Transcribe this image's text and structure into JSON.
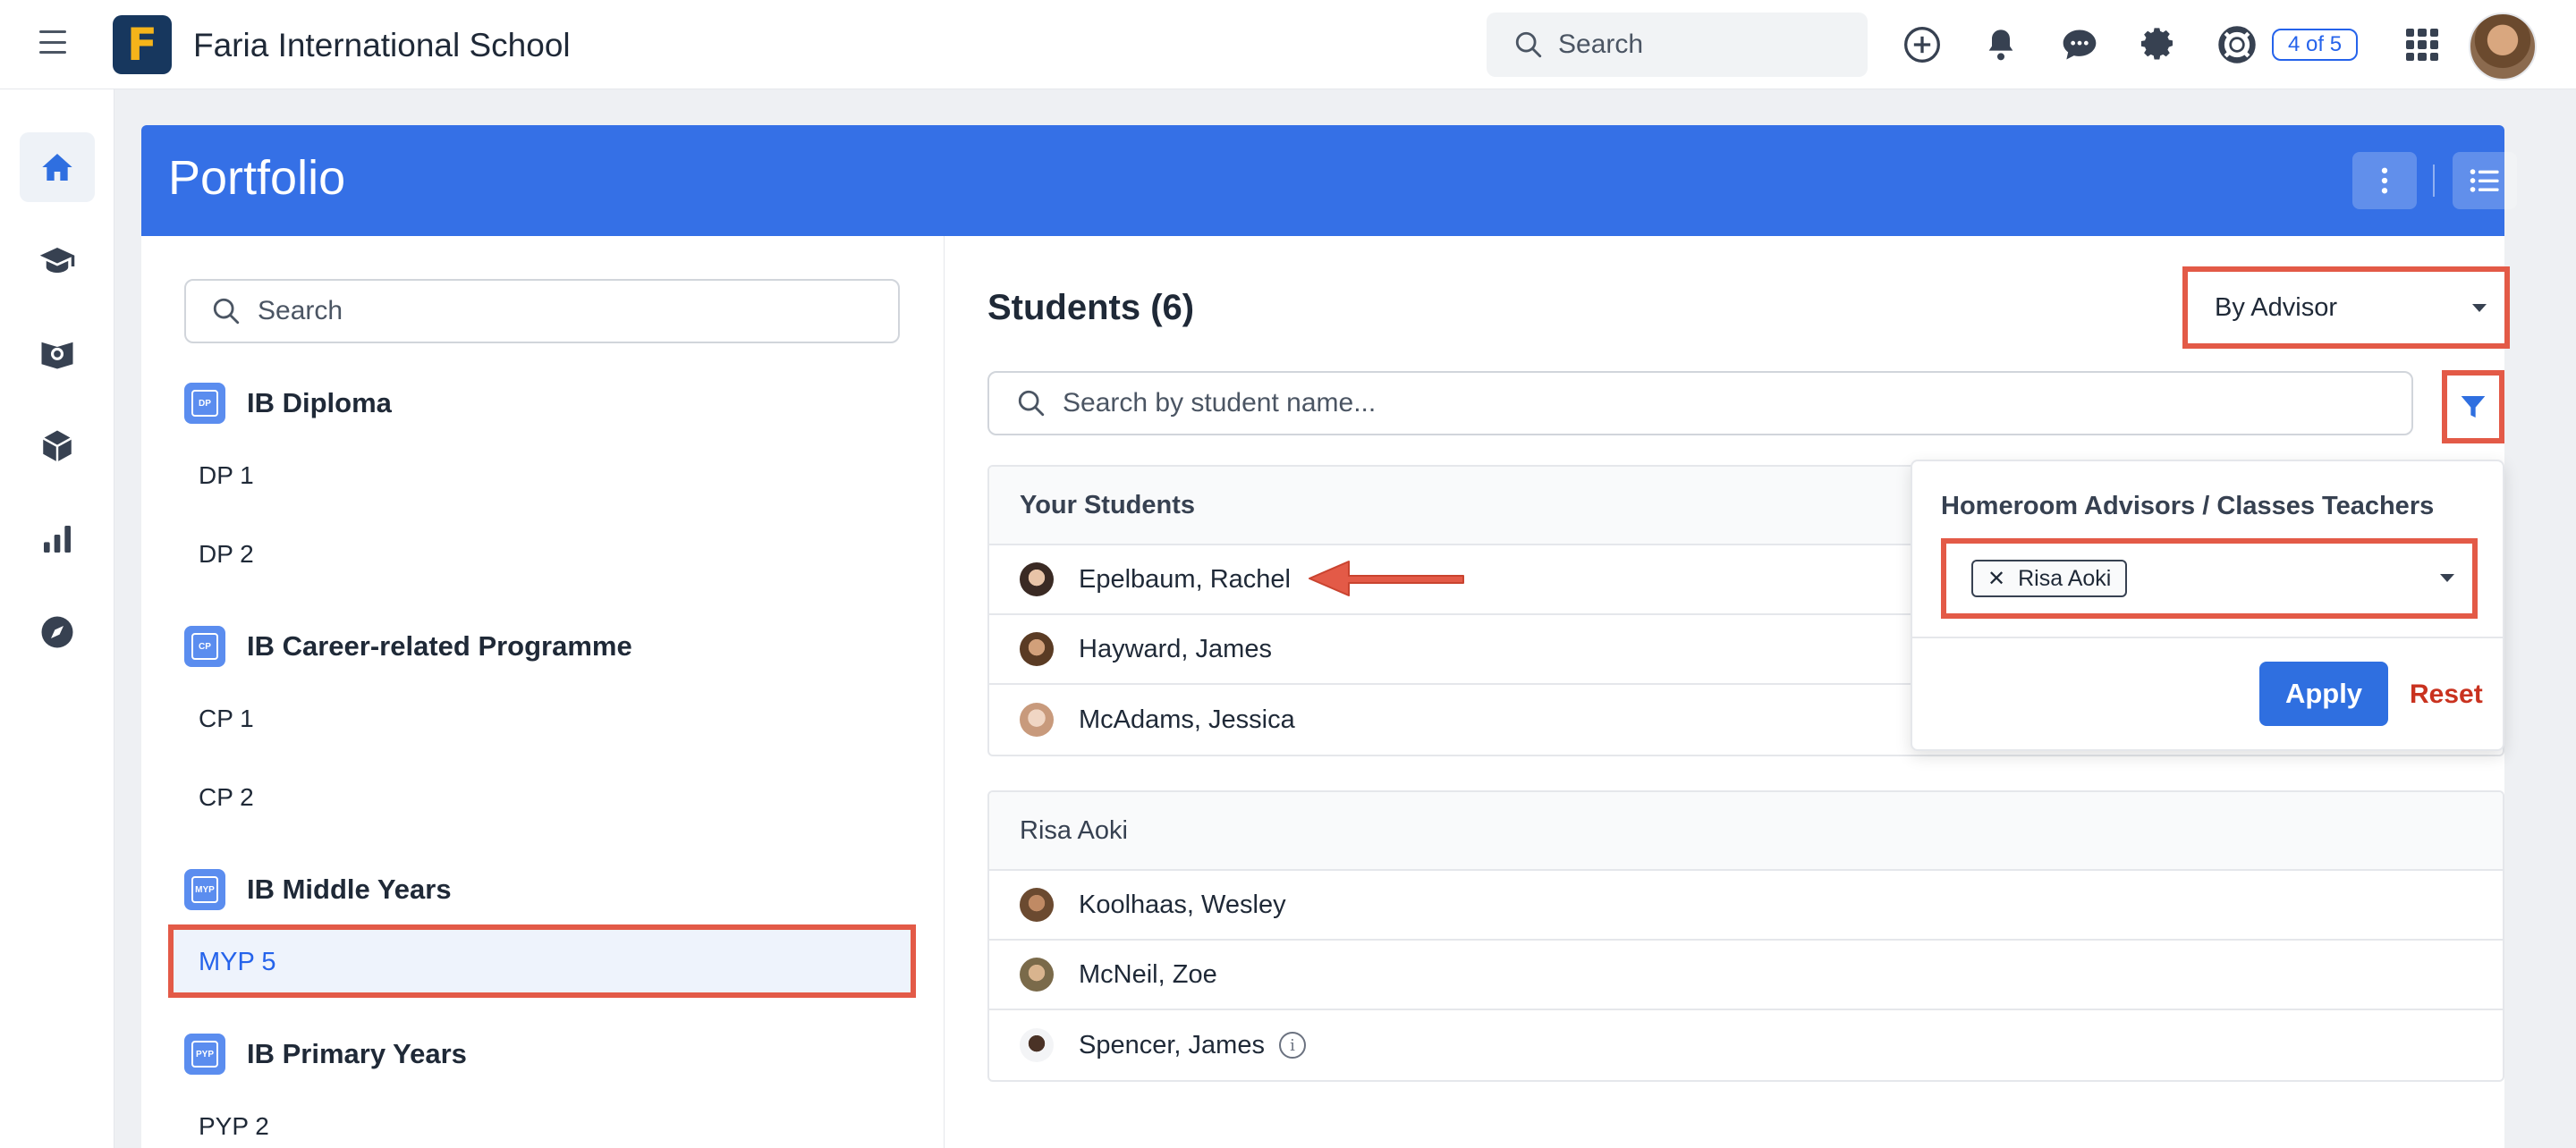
{
  "app": {
    "school_name": "Faria International School",
    "logo_letter": "F"
  },
  "topbar": {
    "search_placeholder": "Search",
    "icons": [
      "add-icon",
      "bell-icon",
      "chat-icon",
      "gear-icon",
      "help-lifebuoy-icon",
      "apps-grid-icon"
    ],
    "progress_badge": "4 of 5"
  },
  "rail": {
    "items": [
      "home-icon",
      "graduation-cap-icon",
      "globe-book-icon",
      "cube-icon",
      "bar-chart-icon",
      "compass-icon"
    ],
    "active": "home-icon"
  },
  "portfolio": {
    "title": "Portfolio",
    "left": {
      "search_placeholder": "Search",
      "programmes": [
        {
          "abbr": "DP",
          "title": "IB Diploma",
          "grades": [
            "DP 1",
            "DP 2"
          ]
        },
        {
          "abbr": "CP",
          "title": "IB Career-related Programme",
          "grades": [
            "CP 1",
            "CP 2"
          ]
        },
        {
          "abbr": "MYP",
          "title": "IB Middle Years",
          "grades": [
            "MYP 5"
          ]
        },
        {
          "abbr": "PYP",
          "title": "IB Primary Years",
          "grades": [
            "PYP 2"
          ]
        }
      ],
      "selected_grade": "MYP 5"
    },
    "right": {
      "students_title": "Students (6)",
      "group_by": "By Advisor",
      "search_placeholder": "Search by student name...",
      "groups": [
        {
          "title": "Your Students",
          "students": [
            "Epelbaum, Rachel",
            "Hayward, James",
            "McAdams, Jessica"
          ]
        },
        {
          "title": "Risa Aoki",
          "students": [
            "Koolhaas, Wesley",
            "McNeil, Zoe",
            "Spencer, James"
          ]
        }
      ]
    },
    "filter_popup": {
      "label": "Homeroom Advisors / Classes Teachers",
      "chip": "Risa Aoki",
      "chip_remove": "✕",
      "apply": "Apply",
      "reset": "Reset"
    }
  },
  "colors": {
    "brand_blue": "#3570e6",
    "highlight_red": "#e35a47",
    "reset_red": "#c9321f"
  }
}
